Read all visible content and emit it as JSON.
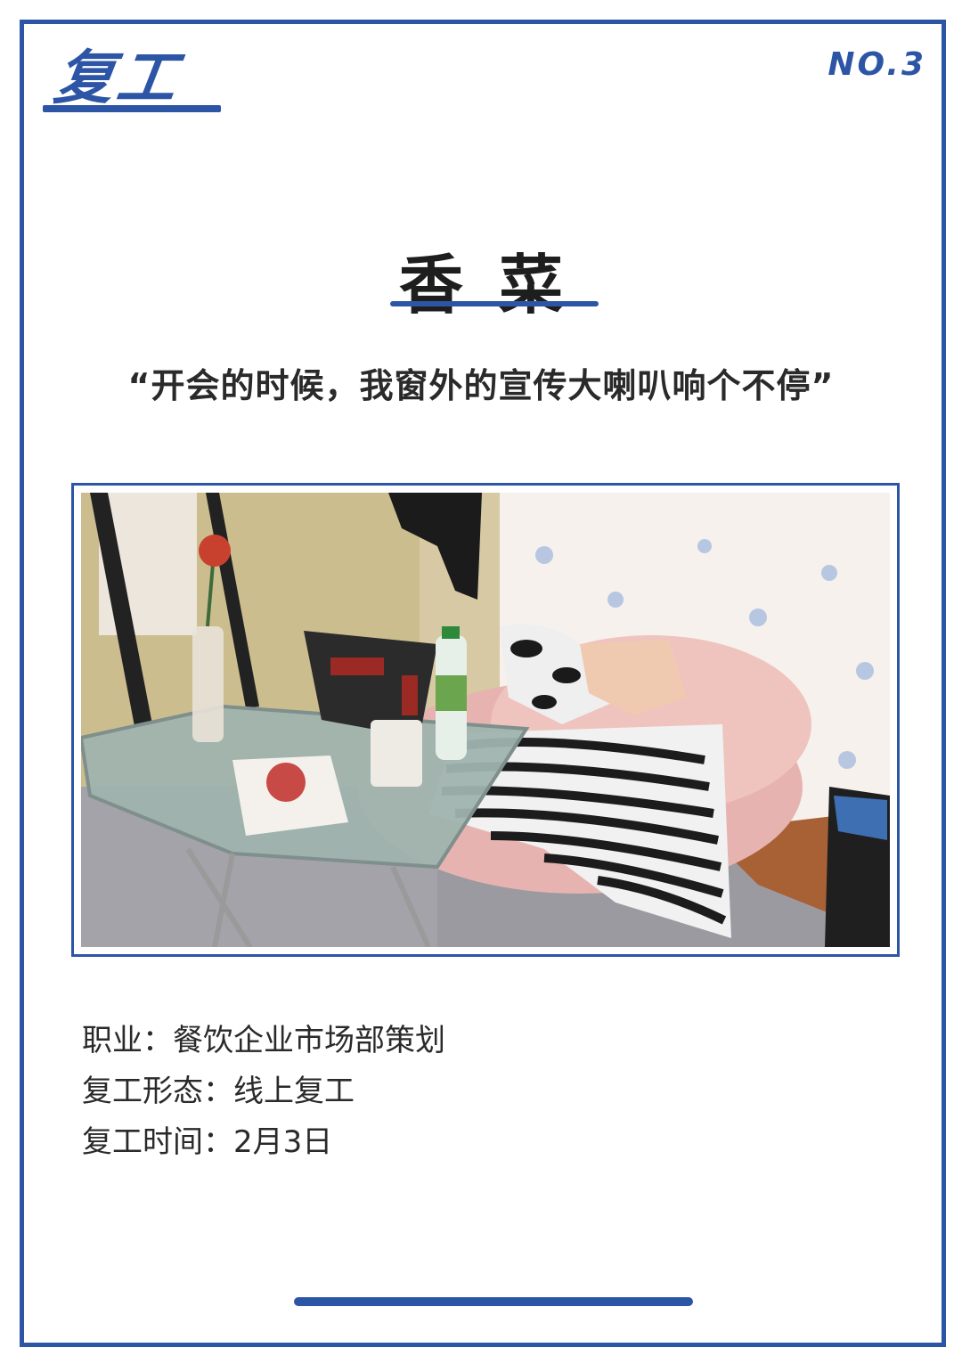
{
  "header": {
    "logo_text": "复工",
    "issue_number": "NO.3"
  },
  "person": {
    "name": "香菜",
    "quote": "“开会的时候，我窗外的宣传大喇叭响个不停”"
  },
  "photo": {
    "description_icon": "workspace-photo"
  },
  "info": [
    {
      "label": "职业：",
      "value": "餐饮企业市场部策划"
    },
    {
      "label": "复工形态：",
      "value": "线上复工"
    },
    {
      "label": "复工时间：",
      "value": "2月3日"
    }
  ],
  "colors": {
    "accent": "#2d55a5",
    "text": "#2a2a2a"
  }
}
